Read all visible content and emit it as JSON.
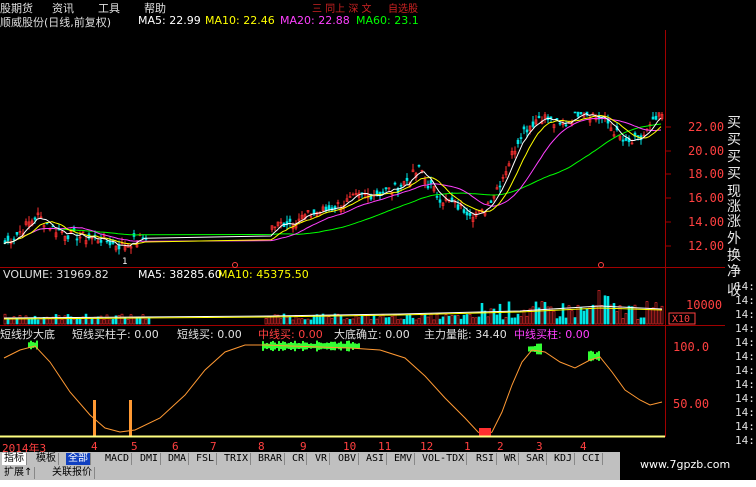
{
  "menu": {
    "items": [
      "股期货",
      "资讯",
      "工具",
      "帮助"
    ],
    "right_items": [
      "三 同上 深 文",
      "自选股"
    ]
  },
  "title": {
    "stock": "顺威股份(日线,前复权)",
    "ma5": "MA5: 22.99",
    "ma10": "MA10: 22.46",
    "ma20": "MA20: 22.88",
    "ma60": "MA60: 23.1"
  },
  "price_axis": [
    "22.00",
    "20.00",
    "18.00",
    "16.00",
    "14.00",
    "12.00"
  ],
  "low_marker": "1",
  "volume": {
    "label": "VOLUME: 31969.82",
    "ma5": "MA5: 38285.60",
    "ma10": "MA10: 45375.50",
    "axis_value": "10000",
    "axis_unit": "X10"
  },
  "indicator": {
    "name": "短线抄大底",
    "f1": "短线买柱子: 0.00",
    "f2": "短线买: 0.00",
    "f3": "中线买: 0.00",
    "f4": "大底确立: 0.00",
    "f5": "主力量能: 34.40",
    "f6": "中线买柱: 0.00",
    "axis": [
      "100.0",
      "50.00"
    ]
  },
  "right_panel": [
    "买",
    "买",
    "买",
    "买",
    "现",
    "涨",
    "涨",
    "外",
    "换",
    "净",
    "收"
  ],
  "right_axis_small": [
    "14:",
    "14:",
    "14:",
    "14:",
    "14:",
    "14:",
    "14:",
    "14:",
    "14:",
    "14:",
    "14:",
    "14:"
  ],
  "months": [
    "2014年3",
    "4",
    "5",
    "6",
    "7",
    "8",
    "9",
    "10",
    "11",
    "12",
    "1",
    "2",
    "3",
    "4"
  ],
  "tabs": {
    "left": [
      "指标",
      "模板",
      "全部"
    ],
    "indicators": [
      "MACD",
      "DMI",
      "DMA",
      "FSL",
      "TRIX",
      "BRAR",
      "CR",
      "VR",
      "OBV",
      "ASI",
      "EMV",
      "VOL-TDX",
      "RSI",
      "WR",
      "SAR",
      "KDJ",
      "CCI"
    ],
    "second_row": [
      "扩展↑",
      "关联报价"
    ]
  },
  "brand": "www.7gpzb.com",
  "colors": {
    "up": "#ff3030",
    "down": "#00e5e5",
    "ma5": "#ffffff",
    "ma10": "#ffff00",
    "ma20": "#ff40ff",
    "ma60": "#00ff00",
    "curve": "#ff9933",
    "highlight": "#33ff33"
  }
}
